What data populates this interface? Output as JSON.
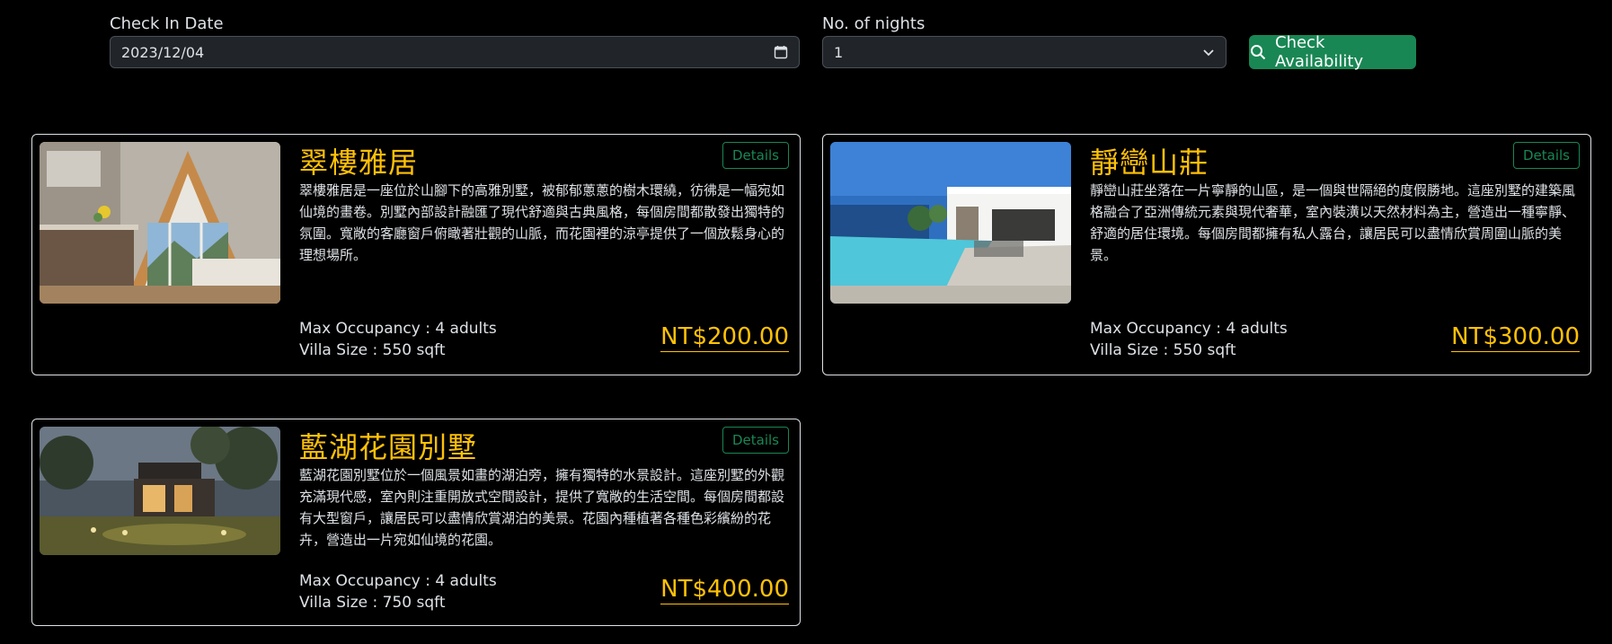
{
  "search": {
    "checkin_label": "Check In Date",
    "checkin_value": "2023/12/04",
    "nights_label": "No. of nights",
    "nights_value": "1",
    "button_label": "Check Availability"
  },
  "colors": {
    "accent": "#ffc107",
    "success": "#198754",
    "background": "#000000"
  },
  "villas": [
    {
      "title": "翠樓雅居",
      "details_label": "Details",
      "description": "翠樓雅居是一座位於山腳下的高雅別墅，被郁郁蔥蔥的樹木環繞，彷彿是一幅宛如仙境的畫卷。別墅內部設計融匯了現代舒適與古典風格，每個房間都散發出獨特的氛圍。寬敞的客廳窗戶俯瞰著壯觀的山脈，而花園裡的涼亭提供了一個放鬆身心的理想場所。",
      "occupancy": "Max Occupancy : 4 adults",
      "size": "Villa Size : 550 sqft",
      "price": "NT$200.00"
    },
    {
      "title": "靜巒山莊",
      "details_label": "Details",
      "description": "靜巒山莊坐落在一片寧靜的山區，是一個與世隔絕的度假勝地。這座別墅的建築風格融合了亞洲傳統元素與現代奢華，室內裝潢以天然材料為主，營造出一種寧靜、舒適的居住環境。每個房間都擁有私人露台，讓居民可以盡情欣賞周圍山脈的美景。",
      "occupancy": "Max Occupancy : 4 adults",
      "size": "Villa Size : 550 sqft",
      "price": "NT$300.00"
    },
    {
      "title": "藍湖花園別墅",
      "details_label": "Details",
      "description": "藍湖花園別墅位於一個風景如畫的湖泊旁，擁有獨特的水景設計。這座別墅的外觀充滿現代感，室內則注重開放式空間設計，提供了寬敞的生活空間。每個房間都設有大型窗戶，讓居民可以盡情欣賞湖泊的美景。花園內種植著各種色彩繽紛的花卉，營造出一片宛如仙境的花園。",
      "occupancy": "Max Occupancy : 4 adults",
      "size": "Villa Size : 750 sqft",
      "price": "NT$400.00"
    }
  ]
}
